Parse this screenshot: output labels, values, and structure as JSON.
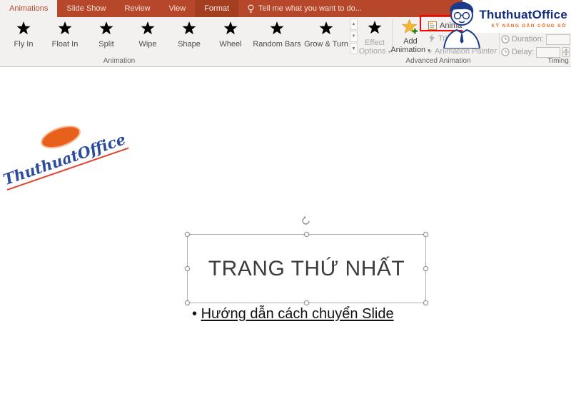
{
  "tabs": {
    "items": [
      {
        "label": "Animations",
        "active": true
      },
      {
        "label": "Slide Show",
        "active": false
      },
      {
        "label": "Review",
        "active": false
      },
      {
        "label": "View",
        "active": false
      },
      {
        "label": "Format",
        "active": false
      }
    ],
    "tell_me": "Tell me what you want to do..."
  },
  "ribbon": {
    "gallery": [
      "Fly In",
      "Float In",
      "Split",
      "Wipe",
      "Shape",
      "Wheel",
      "Random Bars",
      "Grow & Turn"
    ],
    "effect_options": {
      "line1": "Effect",
      "line2": "Options"
    },
    "add_animation": {
      "line1": "Add",
      "line2": "Animation"
    },
    "advanced": {
      "pane": "Animation Pane",
      "trigger": "Trigger",
      "painter": "Animation Painter"
    },
    "timing": {
      "duration_label": "Duration:",
      "delay_label": "Delay:"
    },
    "groups": {
      "animation": "Animation",
      "advanced": "Advanced Animation",
      "timing": "Timing"
    }
  },
  "brand": {
    "name": "ThuthuatOffice",
    "tagline": "KỸ NĂNG DÂN CÔNG SỞ"
  },
  "slide": {
    "logo_script": "ThuthuatOffice",
    "title": "TRANG THỨ NHẤT",
    "bullet_char": "•",
    "bullet_text": "Hướng dẫn cách chuyển Slide"
  },
  "colors": {
    "ribbon_accent": "#B7472A",
    "star_green": "#3E9B4F",
    "annotation_red": "#FF0000",
    "brand_blue": "#142F7E",
    "brand_orange": "#E96A1B"
  }
}
